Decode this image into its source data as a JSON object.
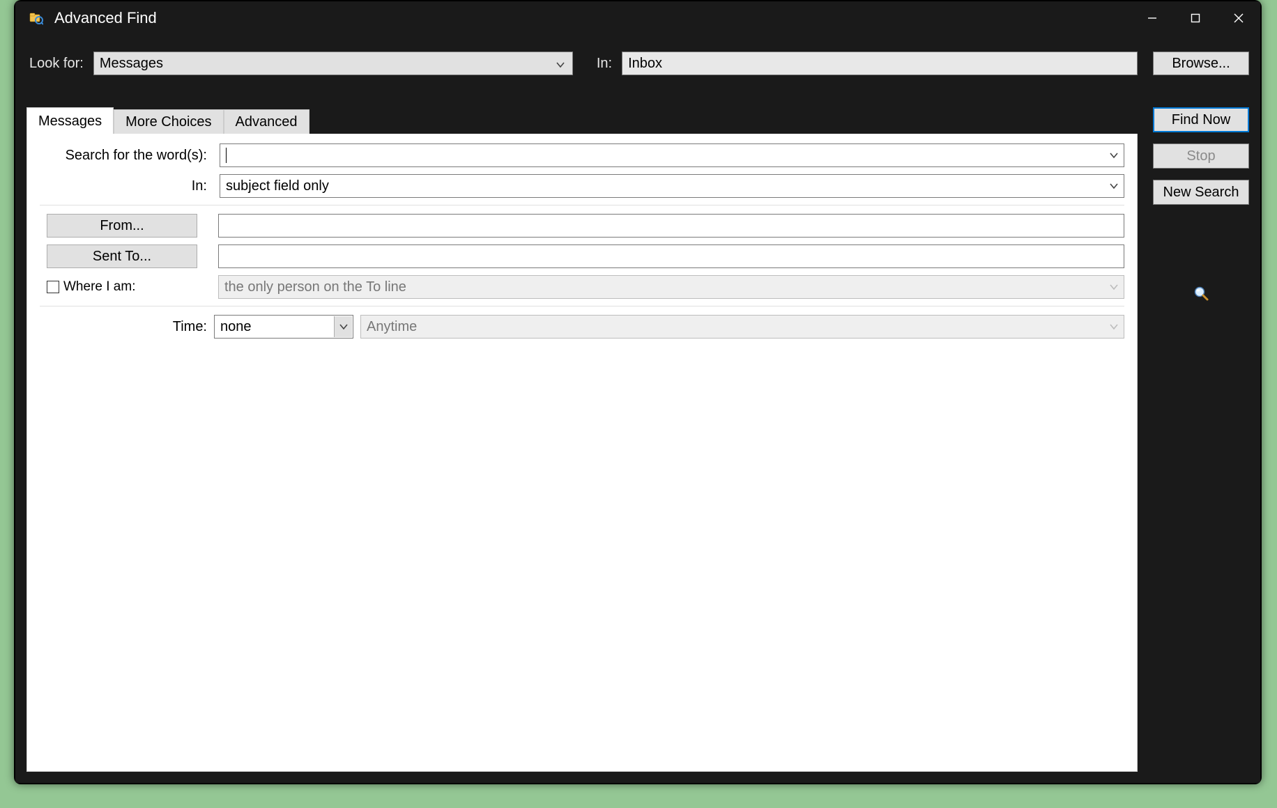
{
  "window": {
    "title": "Advanced Find"
  },
  "topbar": {
    "look_for_label": "Look for:",
    "look_for_value": "Messages",
    "in_label": "In:",
    "in_value": "Inbox",
    "browse_button": "Browse..."
  },
  "side_buttons": {
    "find_now": "Find Now",
    "stop": "Stop",
    "new_search": "New Search"
  },
  "tabs": {
    "messages": "Messages",
    "more_choices": "More Choices",
    "advanced": "Advanced",
    "active": "messages"
  },
  "form": {
    "search_words_label": "Search for the word(s):",
    "search_words_value": "",
    "in_label": "In:",
    "in_value": "subject field only",
    "from_button": "From...",
    "from_value": "",
    "sent_to_button": "Sent To...",
    "sent_to_value": "",
    "where_i_am_label": "Where I am:",
    "where_i_am_checked": false,
    "where_i_am_value": "the only person on the To line",
    "time_label": "Time:",
    "time_value": "none",
    "time_range_value": "Anytime"
  },
  "icons": {
    "magnifier": "🔍"
  }
}
